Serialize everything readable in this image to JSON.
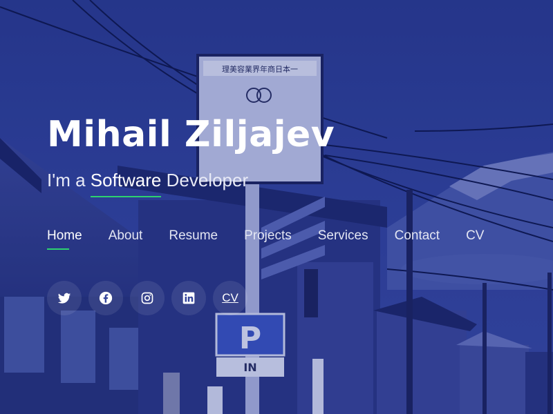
{
  "hero": {
    "name": "Mihail Ziljajev",
    "tagline_prefix": "I'm a ",
    "tagline_typed": "Software",
    "tagline_suffix": " Developer"
  },
  "nav": [
    {
      "label": "Home",
      "active": true
    },
    {
      "label": "About"
    },
    {
      "label": "Resume"
    },
    {
      "label": "Projects"
    },
    {
      "label": "Services"
    },
    {
      "label": "Contact"
    },
    {
      "label": "CV"
    }
  ],
  "social": [
    {
      "name": "twitter-icon"
    },
    {
      "name": "facebook-icon"
    },
    {
      "name": "instagram-icon"
    },
    {
      "name": "linkedin-icon"
    },
    {
      "label": "CV"
    }
  ],
  "background": {
    "sign_text": "理美容業界年商日本一",
    "parking_text": "P",
    "parking_sub": "IN"
  },
  "colors": {
    "accent": "#2dd36f",
    "overlay_blue": "#2d3d8e"
  }
}
